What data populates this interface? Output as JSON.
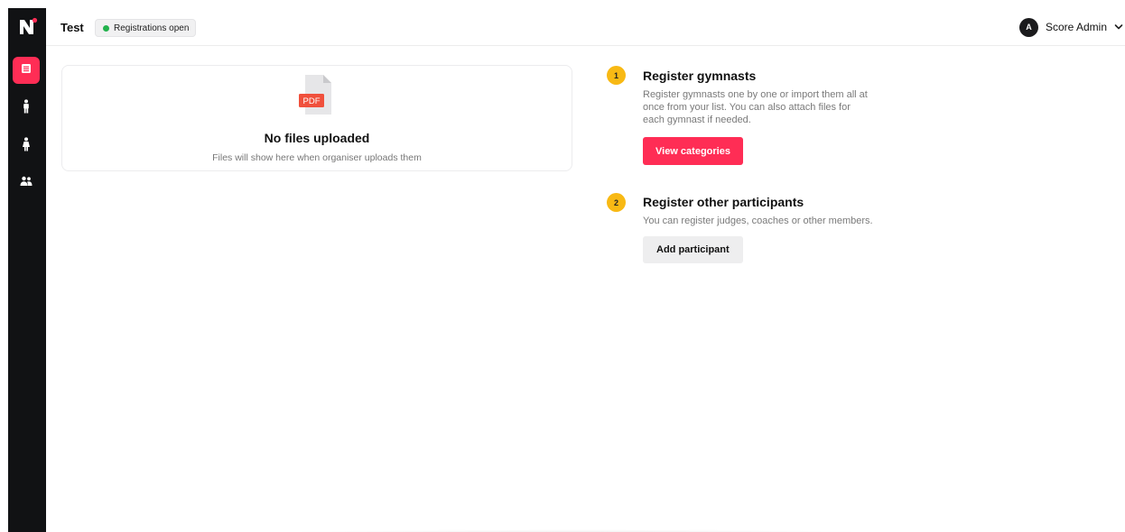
{
  "sidebar": {
    "logo": "N",
    "items": [
      {
        "icon": "registrations-icon",
        "active": true
      },
      {
        "icon": "gymnast-male-icon",
        "active": false
      },
      {
        "icon": "gymnast-female-icon",
        "active": false
      },
      {
        "icon": "participants-icon",
        "active": false
      }
    ]
  },
  "header": {
    "title": "Test",
    "status": "Registrations open",
    "status_color": "#22b24c",
    "user": {
      "initial": "A",
      "name": "Score Admin"
    }
  },
  "files": {
    "icon_label": "PDF",
    "title": "No files uploaded",
    "hint": "Files will show here when organiser uploads them"
  },
  "steps": [
    {
      "number": "1",
      "title": "Register gymnasts",
      "description_lines": [
        "Register gymnasts one by one or import them all at",
        "once from your list. You can also attach files for",
        "each gymnast if needed."
      ],
      "button": "View categories"
    },
    {
      "number": "2",
      "title": "Register other participants",
      "description_lines": [
        "You can register judges, coaches or other members."
      ],
      "button": "Add participant"
    }
  ],
  "colors": {
    "accent": "#ff2d55",
    "step_badge": "#f8b914",
    "sidebar": "#111214"
  }
}
